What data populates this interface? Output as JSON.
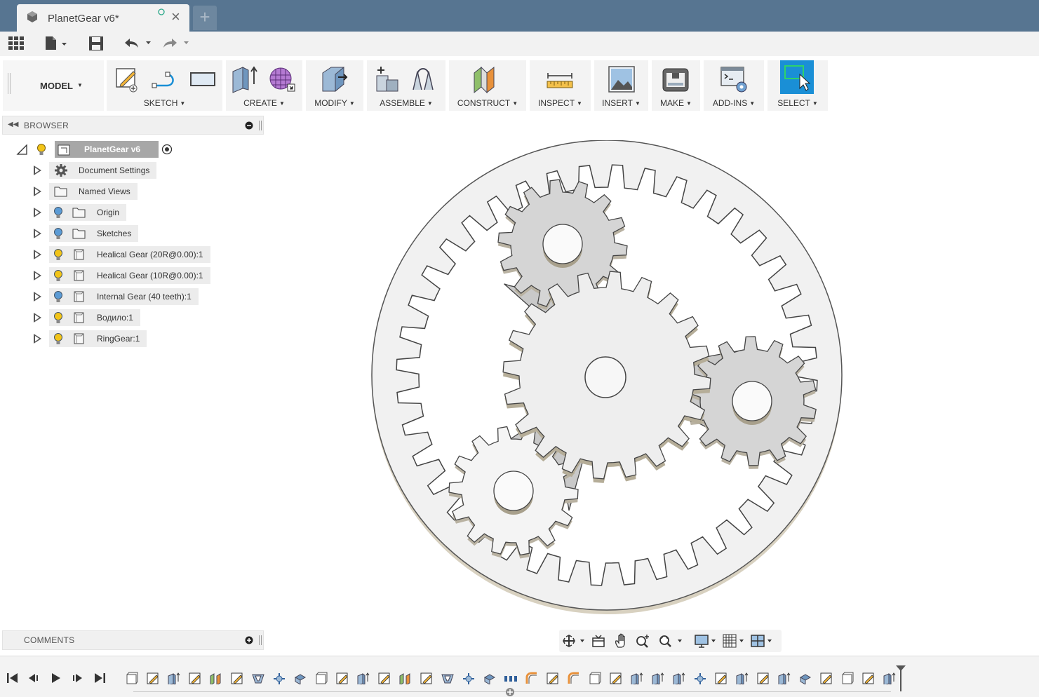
{
  "window": {
    "tab_title": "PlanetGear v6*",
    "new_tab_symbol": "+",
    "close_symbol": "×"
  },
  "toolbar": {
    "workspace": "MODEL",
    "groups": [
      {
        "label": "SKETCH"
      },
      {
        "label": "CREATE"
      },
      {
        "label": "MODIFY"
      },
      {
        "label": "ASSEMBLE"
      },
      {
        "label": "CONSTRUCT"
      },
      {
        "label": "INSPECT"
      },
      {
        "label": "INSERT"
      },
      {
        "label": "MAKE"
      },
      {
        "label": "ADD-INS"
      },
      {
        "label": "SELECT"
      }
    ]
  },
  "browser": {
    "title": "BROWSER",
    "root": "PlanetGear v6",
    "items": [
      {
        "label": "Document Settings",
        "icon": "gear-icon"
      },
      {
        "label": "Named Views",
        "icon": "folder-icon"
      },
      {
        "label": "Origin",
        "icon": "folder-icon",
        "bulb": "blue"
      },
      {
        "label": "Sketches",
        "icon": "folder-icon",
        "bulb": "blue"
      },
      {
        "label": "Healical Gear (20R@0.00):1",
        "icon": "component-icon",
        "bulb": "yellow"
      },
      {
        "label": "Healical Gear (10R@0.00):1",
        "icon": "component-icon",
        "bulb": "yellow"
      },
      {
        "label": "Internal Gear (40 teeth):1",
        "icon": "component-icon",
        "bulb": "blue"
      },
      {
        "label": "Водило:1",
        "icon": "component-icon",
        "bulb": "yellow"
      },
      {
        "label": "RingGear:1",
        "icon": "component-icon",
        "bulb": "yellow"
      }
    ]
  },
  "comments": {
    "title": "COMMENTS"
  },
  "colors": {
    "titlebar": "#577591",
    "select_accent": "#1a8fd6",
    "bulb_yellow": "#f2c418",
    "bulb_blue": "#5b9bd5"
  }
}
